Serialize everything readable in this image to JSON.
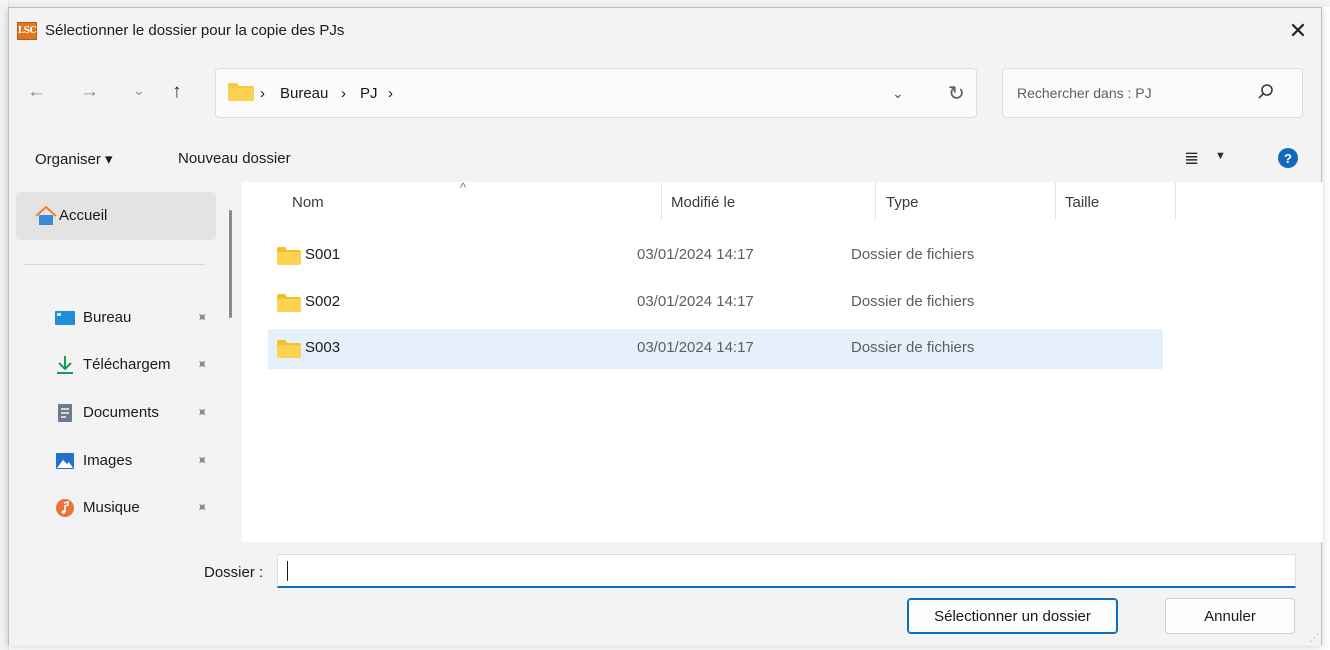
{
  "window": {
    "app_icon_text": "LSC",
    "title": "Sélectionner le dossier pour la copie des PJs",
    "close_glyph": "✕"
  },
  "navigation": {
    "back_glyph": "←",
    "forward_glyph": "→",
    "recent_glyph": "⌄",
    "up_glyph": "↑",
    "breadcrumb": [
      "Bureau",
      "PJ"
    ],
    "breadcrumb_separator": "›",
    "dropdown_glyph": "⌄",
    "refresh_glyph": "↻",
    "search_placeholder": "Rechercher dans : PJ"
  },
  "toolbar": {
    "organize_label": "Organiser ▾",
    "new_folder_label": "Nouveau dossier",
    "view_glyph": "≣",
    "view_caret": "▼",
    "help_glyph": "?"
  },
  "sidebar": {
    "home": {
      "label": "Accueil",
      "icon": "home-icon"
    },
    "items": [
      {
        "label": "Bureau",
        "icon": "desktop-icon",
        "pinned": true
      },
      {
        "label": "Téléchargem",
        "icon": "download-icon",
        "pinned": true
      },
      {
        "label": "Documents",
        "icon": "documents-icon",
        "pinned": true
      },
      {
        "label": "Images",
        "icon": "pictures-icon",
        "pinned": true
      },
      {
        "label": "Musique",
        "icon": "music-icon",
        "pinned": true
      }
    ],
    "pin_glyph": "📌"
  },
  "file_list": {
    "columns": [
      "Nom",
      "Modifié le",
      "Type",
      "Taille"
    ],
    "sort_glyph": "^",
    "rows": [
      {
        "name": "S001",
        "modified": "03/01/2024 14:17",
        "type": "Dossier de fichiers",
        "size": "",
        "selected": false
      },
      {
        "name": "S002",
        "modified": "03/01/2024 14:17",
        "type": "Dossier de fichiers",
        "size": "",
        "selected": false
      },
      {
        "name": "S003",
        "modified": "03/01/2024 14:17",
        "type": "Dossier de fichiers",
        "size": "",
        "selected": true
      }
    ]
  },
  "footer": {
    "folder_label": "Dossier :",
    "folder_value": "",
    "select_button": "Sélectionner un dossier",
    "cancel_button": "Annuler"
  },
  "colors": {
    "accent": "#0f6cbd",
    "selected_row": "#e5f0fb",
    "folder_yellow": "#f8c940",
    "chrome_bg": "#f3f3f3"
  }
}
